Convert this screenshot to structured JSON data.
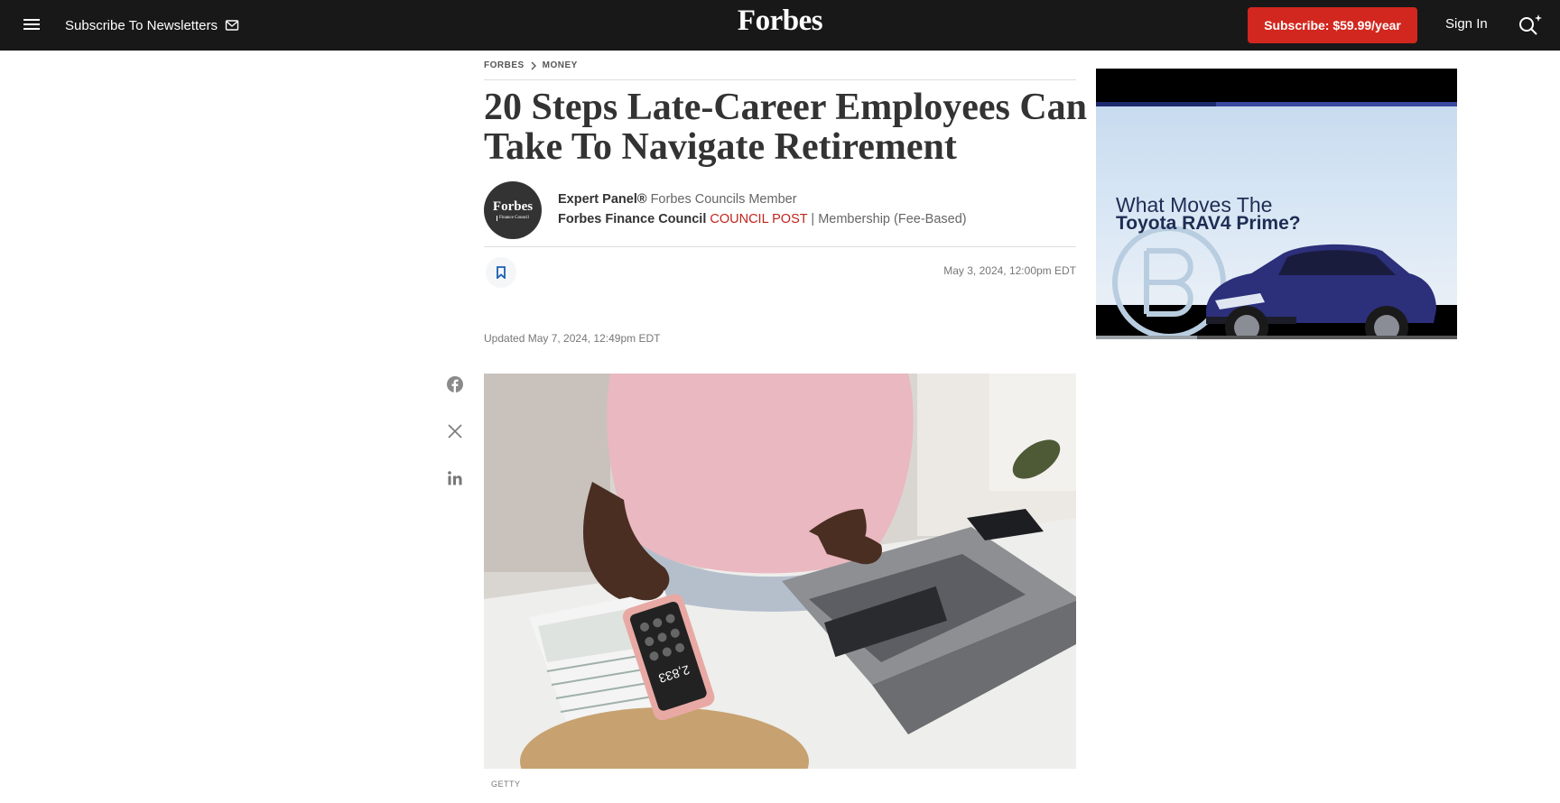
{
  "header": {
    "newsletters_label": "Subscribe To Newsletters",
    "logo": "Forbes",
    "subscribe_label": "Subscribe: $59.99/year",
    "signin_label": "Sign In"
  },
  "breadcrumb": {
    "items": [
      "FORBES",
      "MONEY"
    ]
  },
  "article": {
    "headline": "20 Steps Late-Career Employees Can Take To Navigate Retirement",
    "author": {
      "name": "Expert Panel®",
      "role": "Forbes Councils Member",
      "council": "Forbes Finance Council",
      "post_type": "COUNCIL POST",
      "separator": "|",
      "membership": "Membership (Fee-Based)",
      "avatar_logo": "Forbes",
      "avatar_sub": "Finance Council"
    },
    "published": "May 3, 2024, 12:00pm EDT",
    "updated": "Updated May 7, 2024, 12:49pm EDT",
    "image_caption": "GETTY",
    "calculator_readout": "2,833"
  },
  "share": {
    "icons": [
      "facebook-icon",
      "x-icon",
      "linkedin-icon"
    ]
  },
  "ad": {
    "line1": "What Moves The",
    "line2": "Toyota RAV4 Prime?",
    "progress_fraction": 0.28
  },
  "colors": {
    "topbar": "#181818",
    "subscribe_button": "#d2271e",
    "council_post": "#c2241b",
    "headline": "#333333",
    "ad_text": "#1f2d54"
  }
}
